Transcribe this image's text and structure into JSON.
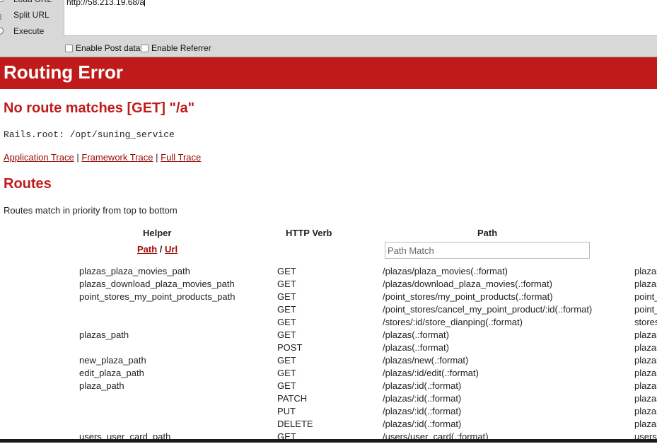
{
  "hackbar": {
    "buttons": {
      "load_url": "Load URL",
      "split_url": "Split URL",
      "execute": "Execute"
    },
    "url_value": "http://58.213.19.68/a",
    "enable_post": "Enable Post data",
    "enable_referrer": "Enable Referrer"
  },
  "error": {
    "title": "Routing Error",
    "message": "No route matches [GET] \"/a\"",
    "rails_root": "Rails.root: /opt/suning_service",
    "traces": {
      "application": "Application Trace",
      "framework": "Framework Trace",
      "full": "Full Trace",
      "separator": "|"
    }
  },
  "routes": {
    "title": "Routes",
    "note": "Routes match in priority from top to bottom",
    "headers": {
      "helper": "Helper",
      "verb": "HTTP Verb",
      "path": "Path"
    },
    "toggle": {
      "path": "Path",
      "sep": "/",
      "url": "Url"
    },
    "path_match_placeholder": "Path Match",
    "rows": [
      {
        "helper": "plazas_plaza_movies_path",
        "verb": "GET",
        "path": "/plazas/plaza_movies(.:format)",
        "ctrl": "plazas"
      },
      {
        "helper": "plazas_download_plaza_movies_path",
        "verb": "GET",
        "path": "/plazas/download_plaza_movies(.:format)",
        "ctrl": "plazas"
      },
      {
        "helper": "point_stores_my_point_products_path",
        "verb": "GET",
        "path": "/point_stores/my_point_products(.:format)",
        "ctrl": "point_"
      },
      {
        "helper": "",
        "verb": "GET",
        "path": "/point_stores/cancel_my_point_product/:id(.:format)",
        "ctrl": "point_"
      },
      {
        "helper": "",
        "verb": "GET",
        "path": "/stores/:id/store_dianping(.:format)",
        "ctrl": "stores"
      },
      {
        "helper": "plazas_path",
        "verb": "GET",
        "path": "/plazas(.:format)",
        "ctrl": "plazas"
      },
      {
        "helper": "",
        "verb": "POST",
        "path": "/plazas(.:format)",
        "ctrl": "plazas"
      },
      {
        "helper": "new_plaza_path",
        "verb": "GET",
        "path": "/plazas/new(.:format)",
        "ctrl": "plazas"
      },
      {
        "helper": "edit_plaza_path",
        "verb": "GET",
        "path": "/plazas/:id/edit(.:format)",
        "ctrl": "plazas"
      },
      {
        "helper": "plaza_path",
        "verb": "GET",
        "path": "/plazas/:id(.:format)",
        "ctrl": "plazas"
      },
      {
        "helper": "",
        "verb": "PATCH",
        "path": "/plazas/:id(.:format)",
        "ctrl": "plazas"
      },
      {
        "helper": "",
        "verb": "PUT",
        "path": "/plazas/:id(.:format)",
        "ctrl": "plazas"
      },
      {
        "helper": "",
        "verb": "DELETE",
        "path": "/plazas/:id(.:format)",
        "ctrl": "plazas"
      },
      {
        "helper": "users_user_card_path",
        "verb": "GET",
        "path": "/users/user_card(.:format)",
        "ctrl": "users"
      }
    ]
  },
  "colors": {
    "header_red": "#c01b1b",
    "link_red": "#980905",
    "toolbar_gray": "#d8d8d8"
  }
}
